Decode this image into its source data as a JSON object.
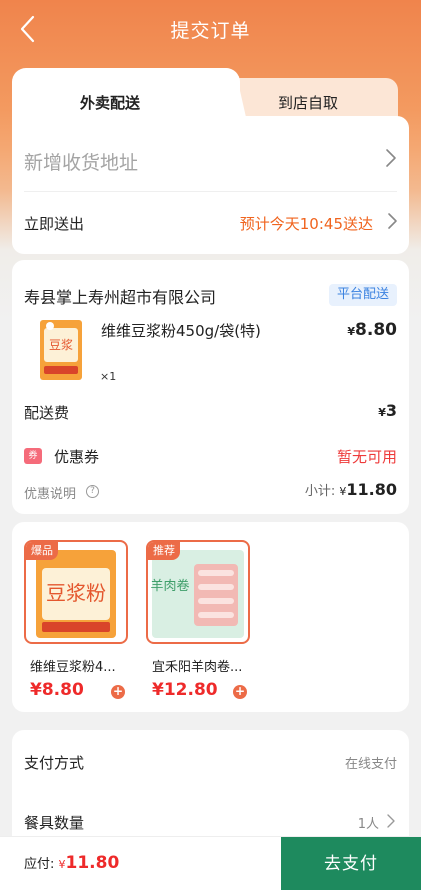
{
  "header": {
    "title": "提交订单",
    "back_icon": "chevron-left-icon"
  },
  "tabs": [
    {
      "label": "外卖配送",
      "active": true
    },
    {
      "label": "到店自取",
      "active": false
    }
  ],
  "address": {
    "placeholder": "新增收货地址"
  },
  "delivery_time": {
    "label": "立即送出",
    "value": "预计今天10:45送达"
  },
  "shop": {
    "name": "寿县掌上寿州超市有限公司",
    "badge": "平台配送",
    "item": {
      "name": "维维豆浆粉450g/袋(特)",
      "quantity": "×1",
      "currency": "¥",
      "price": "8.80"
    },
    "delivery_fee": {
      "label": "配送费",
      "currency": "¥",
      "value": "3"
    },
    "coupon": {
      "icon_text": "券",
      "label": "优惠券",
      "value": "暂无可用"
    },
    "discount_note": {
      "label": "优惠说明",
      "help_icon": "?"
    },
    "subtotal": {
      "label": "小计: ",
      "currency": "¥",
      "value": "11.80"
    }
  },
  "recommendations": [
    {
      "tag": "爆品",
      "name": "维维豆浆粉4...",
      "price": "¥8.80"
    },
    {
      "tag": "推荐",
      "name": "宜禾阳羊肉卷...",
      "price": "¥12.80"
    }
  ],
  "payment": {
    "method_label": "支付方式",
    "method_value": "在线支付",
    "utensils_label": "餐具数量",
    "utensils_value": "1人"
  },
  "footer": {
    "due_label": "应付: ",
    "currency": "¥",
    "amount": "11.80",
    "pay_button": "去支付"
  },
  "colors": {
    "accent_orange": "#f0844c",
    "price_red": "#ee2a2a",
    "pay_green": "#1e8a5e",
    "time_orange": "#f0641e"
  }
}
